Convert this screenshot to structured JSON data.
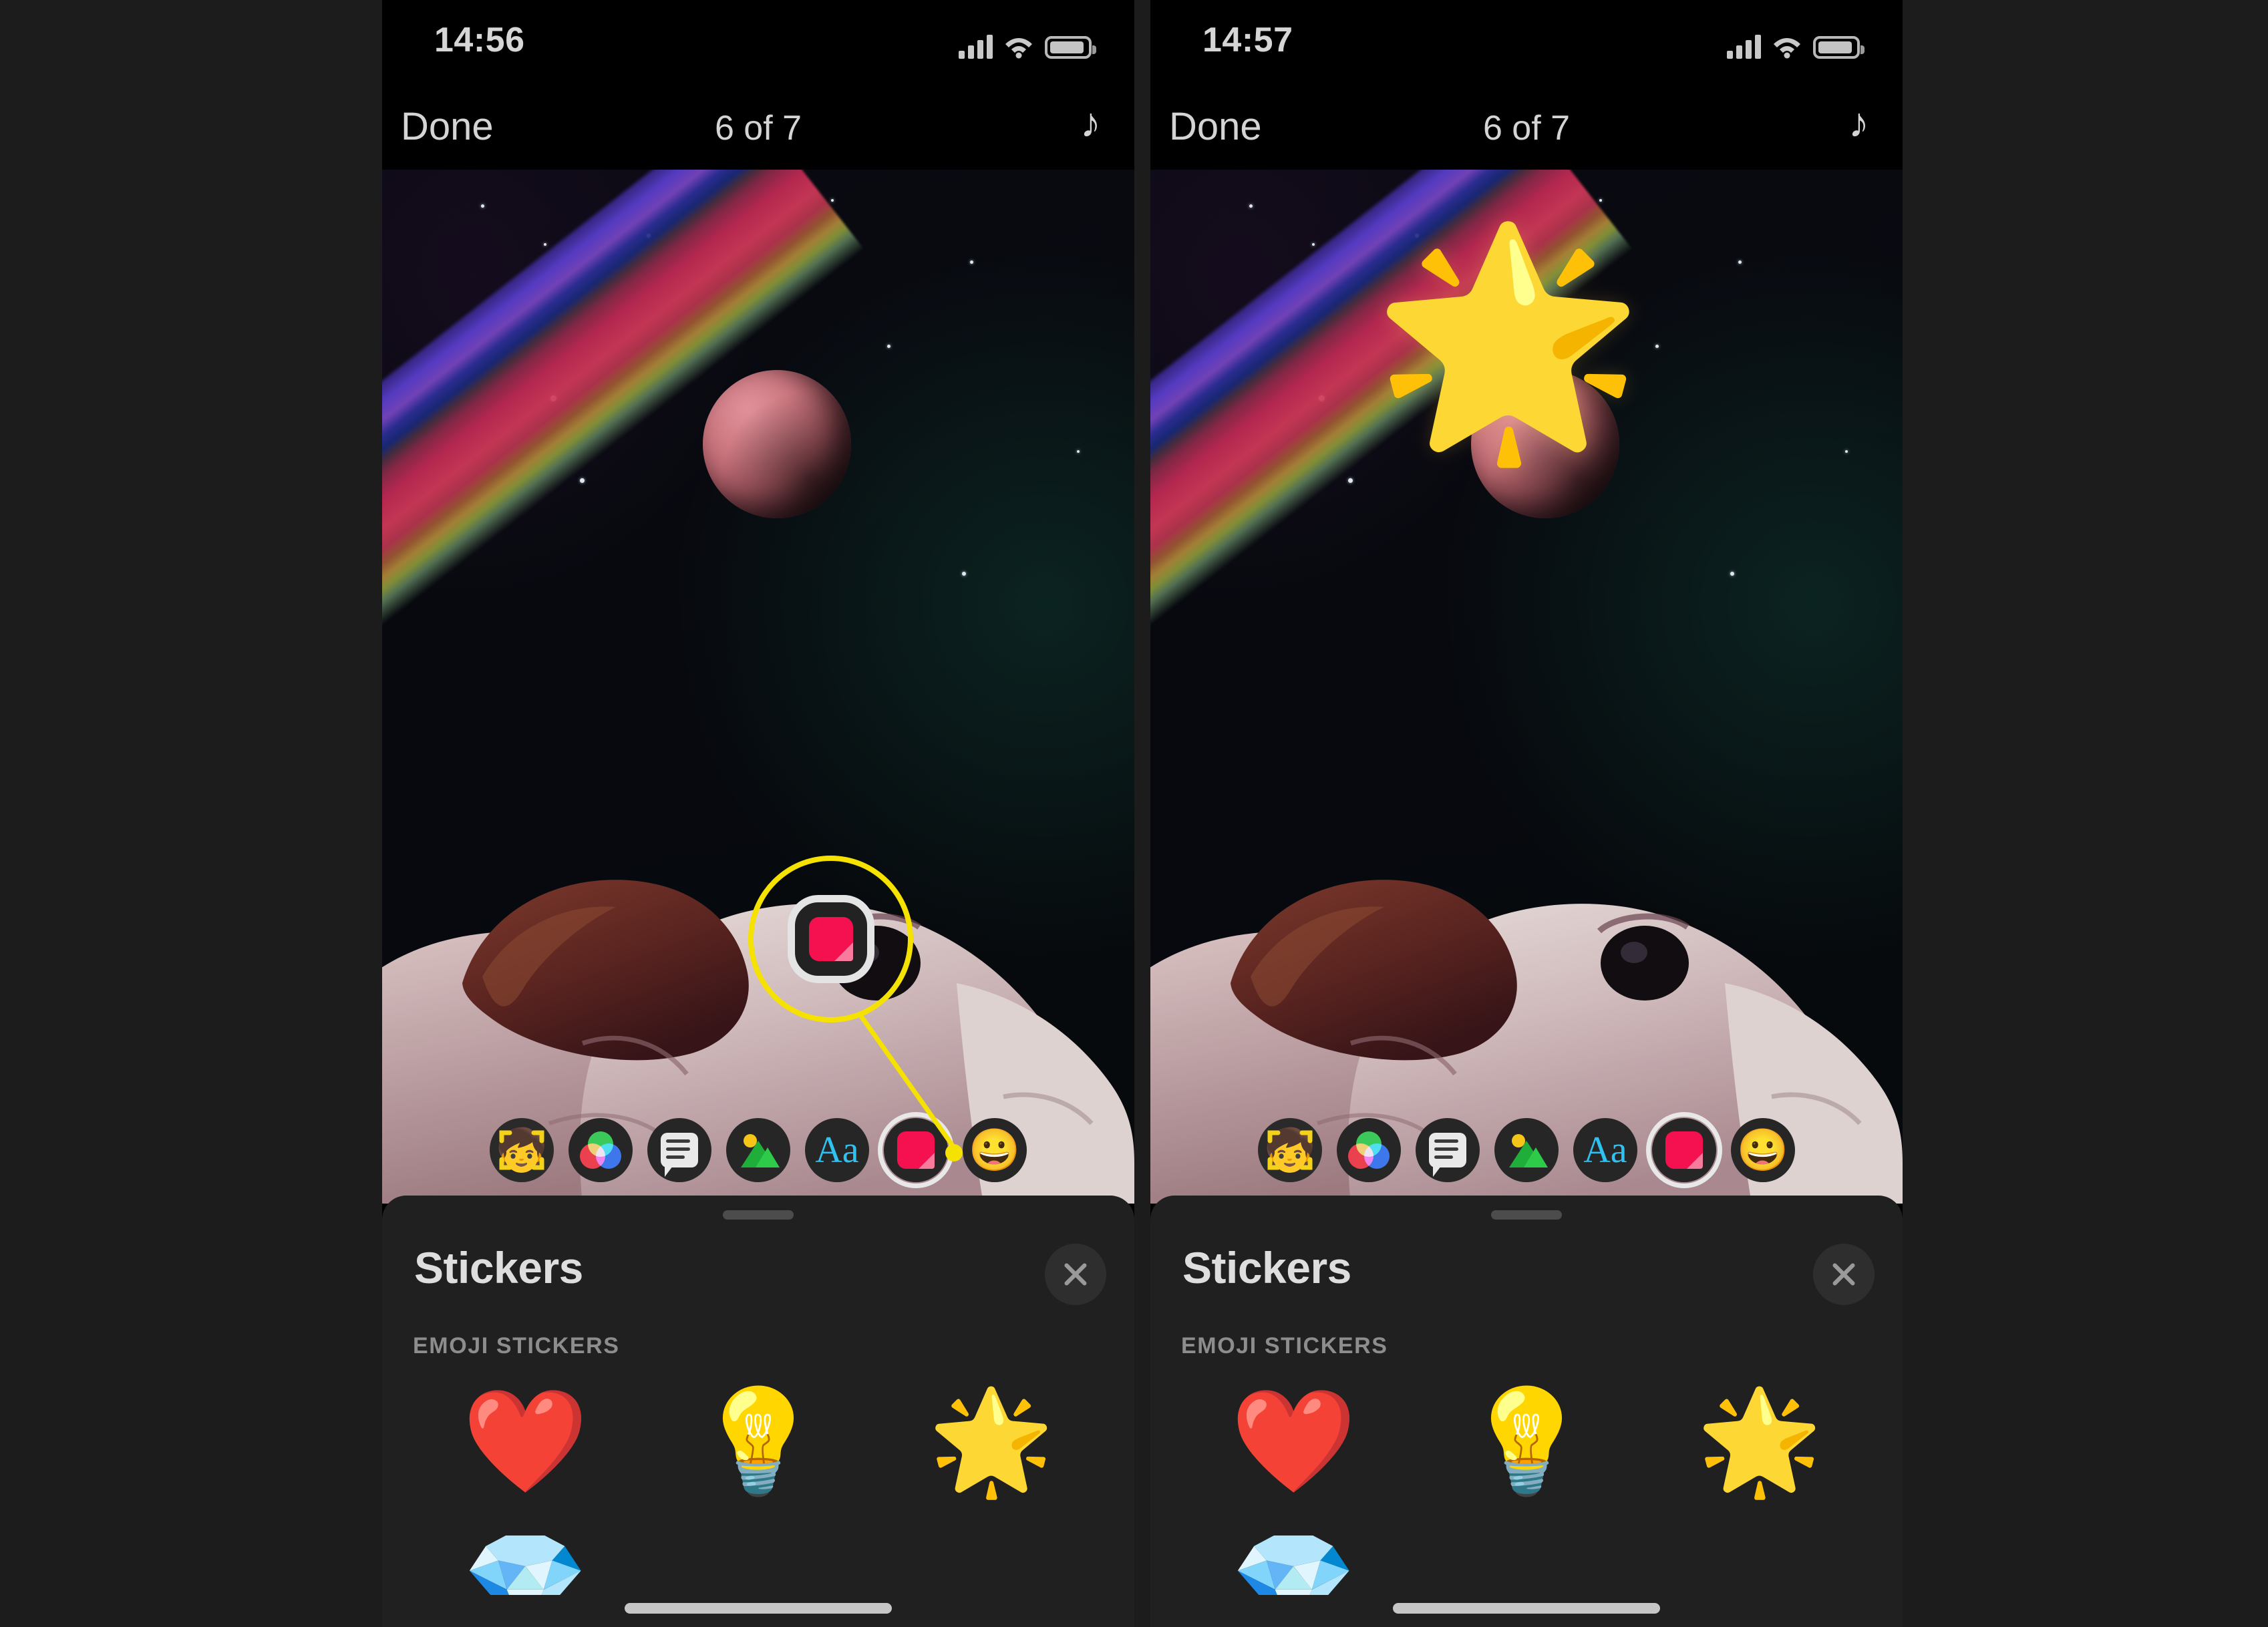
{
  "meta": {
    "app": "Photos Editor — Stickers",
    "accent_yellow": "#f5e200",
    "sticker_pink": "#f5104f",
    "sheet_bg": "#202020",
    "page_bg": "#1c1c1c"
  },
  "phones": [
    {
      "id": "left",
      "status": {
        "time": "14:56",
        "cellular": "signal-bars",
        "wifi": "wifi-icon",
        "battery": "battery-icon"
      },
      "nav": {
        "done_label": "Done",
        "title": "6 of 7",
        "music_icon": "♪"
      },
      "toolbar": {
        "items": [
          {
            "name": "memoji",
            "glyph": "🧒",
            "selected": false
          },
          {
            "name": "filters",
            "glyph": "",
            "selected": false
          },
          {
            "name": "text-bubble",
            "glyph": "",
            "selected": false
          },
          {
            "name": "photos",
            "glyph": "",
            "selected": false
          },
          {
            "name": "text-aa",
            "glyph": "Aa",
            "selected": false
          },
          {
            "name": "stickers",
            "glyph": "",
            "selected": true
          },
          {
            "name": "emoji",
            "glyph": "😀",
            "selected": false
          }
        ]
      },
      "callout": {
        "visible": true,
        "target": "stickers"
      },
      "applied_sticker": null,
      "sheet": {
        "title": "Stickers",
        "close_icon": "close-icon",
        "section_label": "EMOJI STICKERS",
        "stickers": [
          "❤️",
          "💡",
          "🌟"
        ],
        "partial_row": [
          "💎",
          "",
          ""
        ]
      }
    },
    {
      "id": "right",
      "status": {
        "time": "14:57",
        "cellular": "signal-bars",
        "wifi": "wifi-icon",
        "battery": "battery-icon"
      },
      "nav": {
        "done_label": "Done",
        "title": "6 of 7",
        "music_icon": "♪"
      },
      "toolbar": {
        "items": [
          {
            "name": "memoji",
            "glyph": "🧒",
            "selected": false
          },
          {
            "name": "filters",
            "glyph": "",
            "selected": false
          },
          {
            "name": "text-bubble",
            "glyph": "",
            "selected": false
          },
          {
            "name": "photos",
            "glyph": "",
            "selected": false
          },
          {
            "name": "text-aa",
            "glyph": "Aa",
            "selected": false
          },
          {
            "name": "stickers",
            "glyph": "",
            "selected": true
          },
          {
            "name": "emoji",
            "glyph": "😀",
            "selected": false
          }
        ]
      },
      "callout": {
        "visible": false,
        "target": null
      },
      "applied_sticker": "🌟",
      "sheet": {
        "title": "Stickers",
        "close_icon": "close-icon",
        "section_label": "EMOJI STICKERS",
        "stickers": [
          "❤️",
          "💡",
          "🌟"
        ],
        "partial_row": [
          "💎",
          "",
          ""
        ]
      }
    }
  ]
}
